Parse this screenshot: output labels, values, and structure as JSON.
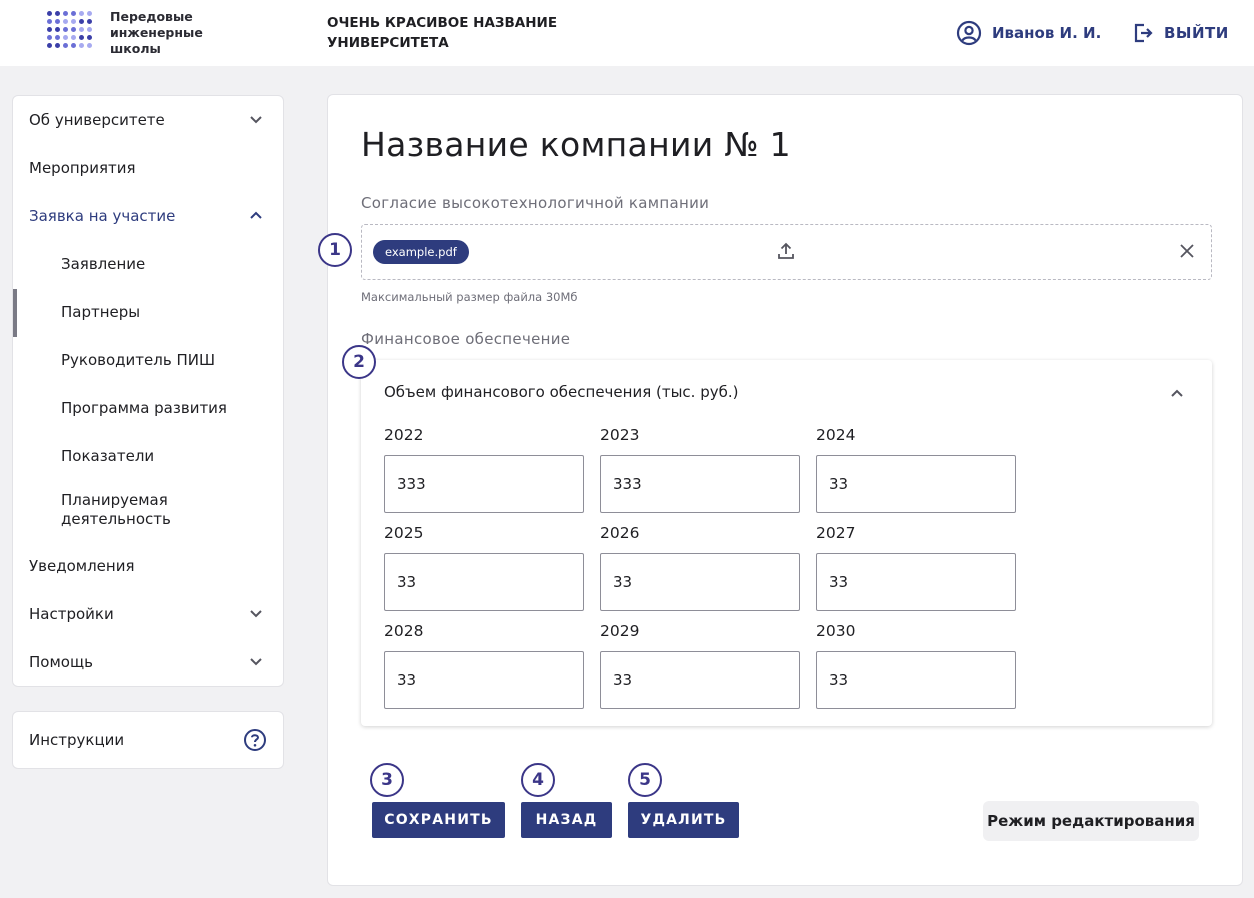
{
  "header": {
    "logo_text": "Передовые инженерные школы",
    "logo_colors": [
      "#3b3fa8",
      "#6b6fd6",
      "#a7aaf0"
    ],
    "university_name": "ОЧЕНЬ КРАСИВОЕ НАЗВАНИЕ УНИВЕРСИТЕТА",
    "user_name": "Иванов И. И.",
    "logout_label": "ВЫЙТИ"
  },
  "sidebar": {
    "items": [
      {
        "label": "Об университете",
        "icon": "chevron-down-icon"
      },
      {
        "label": "Мероприятия"
      },
      {
        "label": "Заявка на участие",
        "icon": "chevron-up-icon"
      },
      {
        "label": "Заявление"
      },
      {
        "label": "Партнеры"
      },
      {
        "label": "Руководитель ПИШ"
      },
      {
        "label": "Программа развития"
      },
      {
        "label": "Показатели"
      },
      {
        "label": "Планируемая деятельность"
      },
      {
        "label": "Уведомления"
      },
      {
        "label": "Настройки",
        "icon": "chevron-down-icon"
      },
      {
        "label": "Помощь",
        "icon": "chevron-down-icon"
      }
    ],
    "instructions_label": "Инструкции"
  },
  "main": {
    "title": "Название компании № 1",
    "consent_label": "Согласие высокотехнологичной кампании",
    "file_chip": "example.pdf",
    "file_hint": "Максимальный размер файла 30Мб",
    "financial_label": "Финансовое обеспечение",
    "financial_card_title": "Объем финансового обеспечения (тыс. руб.)",
    "years": [
      {
        "year": "2022",
        "value": "333"
      },
      {
        "year": "2023",
        "value": "333"
      },
      {
        "year": "2024",
        "value": "33"
      },
      {
        "year": "2025",
        "value": "33"
      },
      {
        "year": "2026",
        "value": "33"
      },
      {
        "year": "2027",
        "value": "33"
      },
      {
        "year": "2028",
        "value": "33"
      },
      {
        "year": "2029",
        "value": "33"
      },
      {
        "year": "2030",
        "value": "33"
      }
    ],
    "buttons": {
      "save": "СОХРАНИТЬ",
      "back": "НАЗАД",
      "delete": "УДАЛИТЬ",
      "edit_mode": "Режим редактирования"
    },
    "badges": [
      "1",
      "2",
      "3",
      "4",
      "5"
    ]
  },
  "colors": {
    "accent": "#2e3c7e",
    "badge": "#3b3688",
    "background": "#f1f1f3"
  }
}
